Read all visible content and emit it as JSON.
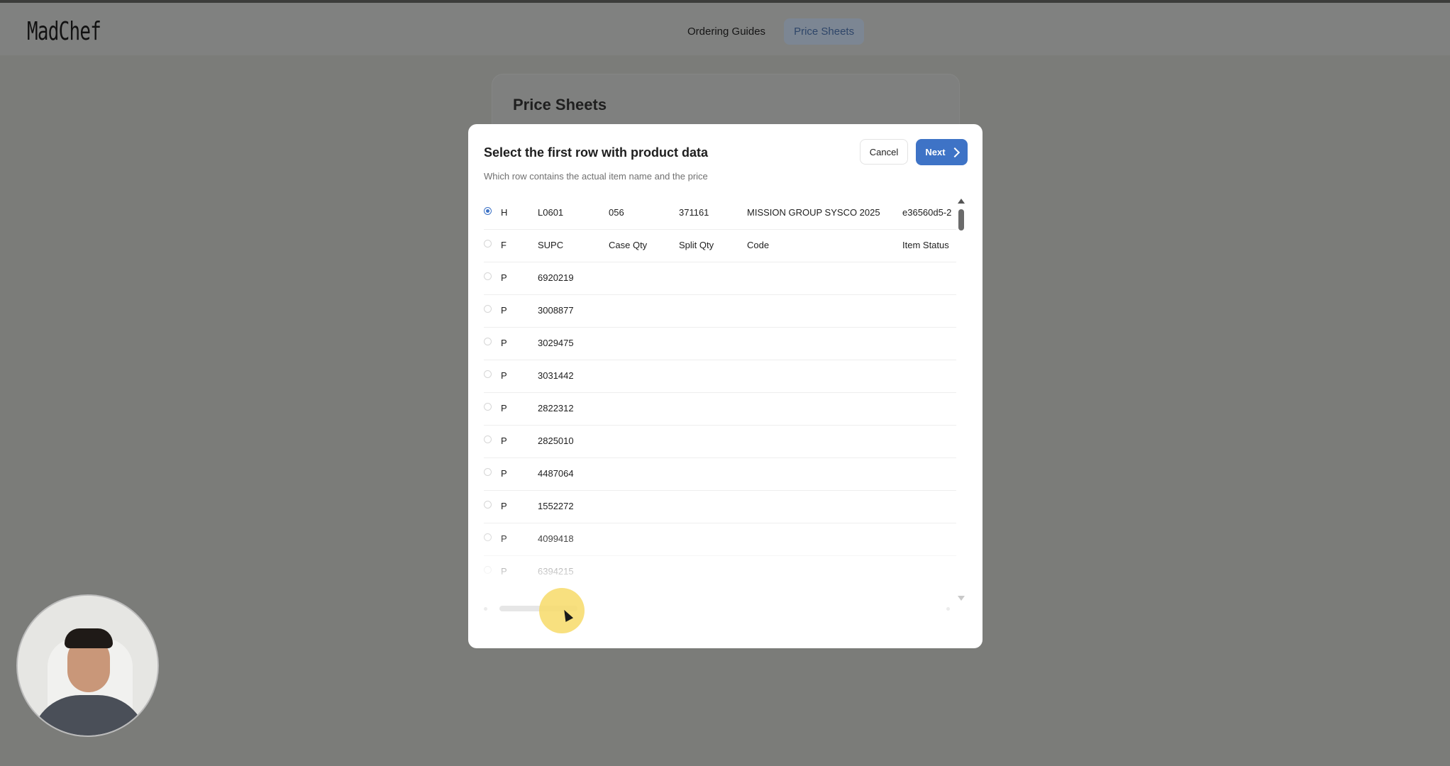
{
  "app": {
    "logo": "MadChef",
    "nav": [
      {
        "label": "Ordering Guides",
        "active": false
      },
      {
        "label": "Price Sheets",
        "active": true
      }
    ]
  },
  "background_card": {
    "title": "Price Sheets"
  },
  "modal": {
    "title": "Select the first row with product data",
    "subtitle": "Which row contains the actual item name and the price",
    "cancel_label": "Cancel",
    "next_label": "Next",
    "rows": [
      {
        "type": "H",
        "a": "L0601",
        "b": "056",
        "c": "371161",
        "d": "MISSION GROUP SYSCO 2025",
        "e": "e36560d5-2",
        "selected": true
      },
      {
        "type": "F",
        "a": "SUPC",
        "b": "Case Qty",
        "c": "Split Qty",
        "d": "Code",
        "e": "Item Status",
        "selected": false
      },
      {
        "type": "P",
        "a": "6920219",
        "b": "",
        "c": "",
        "d": "",
        "e": "",
        "selected": false
      },
      {
        "type": "P",
        "a": "3008877",
        "b": "",
        "c": "",
        "d": "",
        "e": "",
        "selected": false
      },
      {
        "type": "P",
        "a": "3029475",
        "b": "",
        "c": "",
        "d": "",
        "e": "",
        "selected": false
      },
      {
        "type": "P",
        "a": "3031442",
        "b": "",
        "c": "",
        "d": "",
        "e": "",
        "selected": false
      },
      {
        "type": "P",
        "a": "2822312",
        "b": "",
        "c": "",
        "d": "",
        "e": "",
        "selected": false
      },
      {
        "type": "P",
        "a": "2825010",
        "b": "",
        "c": "",
        "d": "",
        "e": "",
        "selected": false
      },
      {
        "type": "P",
        "a": "4487064",
        "b": "",
        "c": "",
        "d": "",
        "e": "",
        "selected": false
      },
      {
        "type": "P",
        "a": "1552272",
        "b": "",
        "c": "",
        "d": "",
        "e": "",
        "selected": false
      },
      {
        "type": "P",
        "a": "4099418",
        "b": "",
        "c": "",
        "d": "",
        "e": "",
        "selected": false
      },
      {
        "type": "P",
        "a": "6394215",
        "b": "",
        "c": "",
        "d": "",
        "e": "",
        "selected": false
      }
    ]
  },
  "colors": {
    "accent": "#3e73c6",
    "overlay": "#7b7c79",
    "click_highlight": "#f7db68"
  },
  "icons": {
    "next": "chevron-right-icon",
    "scroll_up": "arrow-up-icon",
    "scroll_down": "arrow-down-icon",
    "cursor": "cursor-icon"
  }
}
